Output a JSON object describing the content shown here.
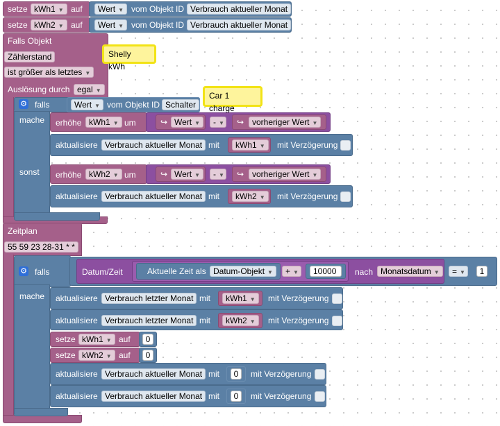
{
  "setze_rows": [
    {
      "setze": "setze",
      "var": "kWh1",
      "auf": "auf",
      "wert": "Wert",
      "vom": "vom Objekt ID",
      "obj": "Verbrauch aktueller Monat"
    },
    {
      "setze": "setze",
      "var": "kWh2",
      "auf": "auf",
      "wert": "Wert",
      "vom": "vom Objekt ID",
      "obj": "Verbrauch aktueller Monat"
    }
  ],
  "trigger1": {
    "title": "Falls Objekt",
    "objekt": "Zählerstand",
    "condition": "ist größer als letztes",
    "ausloesung": "Auslösung durch",
    "ausloesung_value": "egal",
    "note": "Shelly kWh"
  },
  "if1": {
    "falls": "falls",
    "wert": "Wert",
    "vom": "vom Objekt ID",
    "obj": "Schalter",
    "note": "Car 1 charge",
    "mache": "mache",
    "sonst": "sonst",
    "mache_rows": [
      {
        "erhoehe": "erhöhe",
        "var": "kWh1",
        "um": "um",
        "a": "Wert",
        "op": "-",
        "b": "vorheriger Wert"
      },
      {
        "aktualisiere": "aktualisiere",
        "obj": "Verbrauch aktueller Monat",
        "mit": "mit",
        "val": "kWh1",
        "delay": "mit Verzögerung"
      }
    ],
    "sonst_rows": [
      {
        "erhoehe": "erhöhe",
        "var": "kWh2",
        "um": "um",
        "a": "Wert",
        "op": "-",
        "b": "vorheriger Wert"
      },
      {
        "aktualisiere": "aktualisiere",
        "obj": "Verbrauch aktueller Monat",
        "mit": "mit",
        "val": "kWh2",
        "delay": "mit Verzögerung"
      }
    ]
  },
  "schedule": {
    "title": "Zeitplan",
    "cron": "55 59 23 28-31 * *"
  },
  "if2": {
    "falls": "falls",
    "datum": "Datum/Zeit",
    "zeit": "Aktuelle Zeit als",
    "format": "Datum-Objekt",
    "plus": "+",
    "num": "10000",
    "nach": "nach",
    "monats": "Monatsdatum",
    "eq": "=",
    "cmp": "1",
    "mache": "mache",
    "rows": [
      {
        "aktualisiere": "aktualisiere",
        "obj": "Verbrauch letzter Monat",
        "mit": "mit",
        "val": "kWh1",
        "delay": "mit Verzögerung"
      },
      {
        "aktualisiere": "aktualisiere",
        "obj": "Verbrauch letzter Monat",
        "mit": "mit",
        "val": "kWh2",
        "delay": "mit Verzögerung"
      }
    ],
    "setze": [
      {
        "setze": "setze",
        "var": "kWh1",
        "auf": "auf",
        "val": "0"
      },
      {
        "setze": "setze",
        "var": "kWh2",
        "auf": "auf",
        "val": "0"
      }
    ],
    "rows2": [
      {
        "aktualisiere": "aktualisiere",
        "obj": "Verbrauch aktueller Monat",
        "mit": "mit",
        "val": "0",
        "delay": "mit Verzögerung"
      },
      {
        "aktualisiere": "aktualisiere",
        "obj": "Verbrauch aktueller Monat",
        "mit": "mit",
        "val": "0",
        "delay": "mit Verzögerung"
      }
    ]
  }
}
